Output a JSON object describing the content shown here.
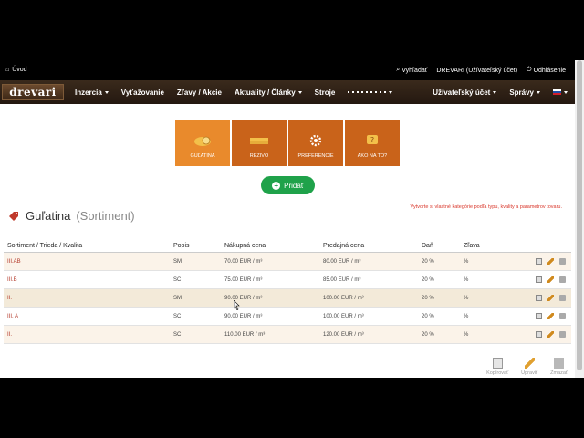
{
  "topbar": {
    "home": "Úvod",
    "search": "Vyhľadať",
    "account": "DREVARI (Užívateľský účet)",
    "logout": "Odhlásenie"
  },
  "nav": {
    "logo": "drevari",
    "items": [
      "Inzercia",
      "Vyťažovanie",
      "Zľavy / Akcie",
      "Aktuality / Články",
      "Stroje"
    ],
    "right": [
      "Užívateľský účet",
      "Správy"
    ]
  },
  "tiles": [
    {
      "label": "GUĽATINA",
      "icon": "log-icon"
    },
    {
      "label": "REZIVO",
      "icon": "lumber-icon"
    },
    {
      "label": "PREFERENCIE",
      "icon": "gear-icon"
    },
    {
      "label": "AKO NA TO?",
      "icon": "question-icon"
    }
  ],
  "add_button": "Pridať",
  "hint": "Vytvorte si vlastné kategórie podľa typu, kvality a parametrov tovaru.",
  "page": {
    "title": "Guľatina",
    "subtitle": "(Sortiment)"
  },
  "table": {
    "headers": [
      "Sortiment / Trieda / Kvalita",
      "Popis",
      "Nákupná cena",
      "Predajná cena",
      "Daň",
      "Zľava"
    ],
    "rows": [
      {
        "sortiment": "III.AB",
        "popis": "SM",
        "nakup": "70.00 EUR / m³",
        "predaj": "80.00 EUR / m³",
        "dan": "20 %",
        "zlava": "%"
      },
      {
        "sortiment": "III.B",
        "popis": "SC",
        "nakup": "75.00 EUR / m³",
        "predaj": "85.00 EUR / m³",
        "dan": "20 %",
        "zlava": "%"
      },
      {
        "sortiment": "II.",
        "popis": "SM",
        "nakup": "90.00 EUR / m³",
        "predaj": "100.00 EUR / m³",
        "dan": "20 %",
        "zlava": "%"
      },
      {
        "sortiment": "III. A",
        "popis": "SC",
        "nakup": "90.00 EUR / m³",
        "predaj": "100.00 EUR / m³",
        "dan": "20 %",
        "zlava": "%"
      },
      {
        "sortiment": "II.",
        "popis": "SC",
        "nakup": "110.00 EUR / m³",
        "predaj": "120.00 EUR / m³",
        "dan": "20 %",
        "zlava": "%"
      }
    ]
  },
  "bottom_actions": {
    "copy": "Kopírovať",
    "edit": "Upraviť",
    "delete": "Zmazať"
  },
  "colors": {
    "accent": "#c9631a",
    "accent_active": "#e98a2c",
    "add": "#1fa24a",
    "hint": "#d9372b"
  }
}
